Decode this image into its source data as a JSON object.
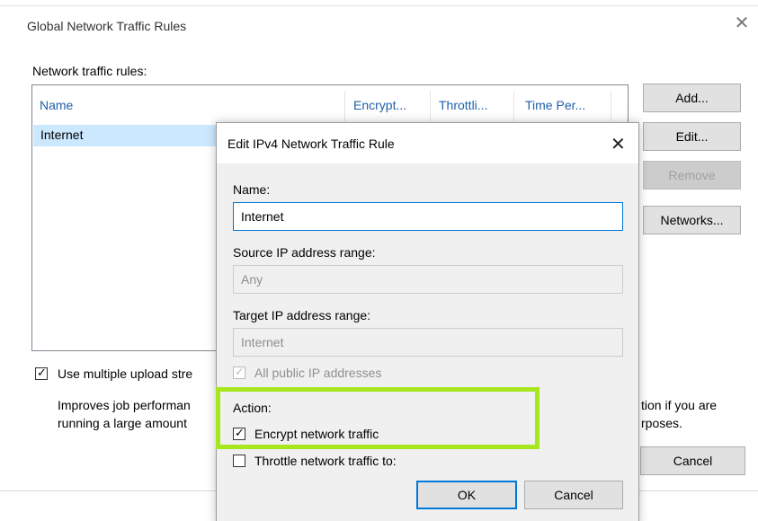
{
  "outer": {
    "title": "Global Network Traffic Rules",
    "close_glyph": "✕",
    "rules_label": "Network traffic rules:",
    "columns": [
      "Name",
      "Encrypt...",
      "Throttli...",
      "Time Per..."
    ],
    "rows": [
      {
        "name": "Internet"
      }
    ],
    "buttons": {
      "add": "Add...",
      "edit": "Edit...",
      "remove": "Remove",
      "networks": "Networks...",
      "cancel": "Cancel"
    },
    "multi_upload_label": "Use multiple upload stre",
    "description_left_1": "Improves job performan",
    "description_left_2": "running a large amount",
    "description_right_1": "tion if you are",
    "description_right_2": "rposes."
  },
  "inner": {
    "title": "Edit IPv4 Network Traffic Rule",
    "close_glyph": "✕",
    "name_label": "Name:",
    "name_value": "Internet",
    "source_label": "Source IP address range:",
    "source_value": "Any",
    "target_label": "Target IP address range:",
    "target_value": "Internet",
    "all_public_label": "All public IP addresses",
    "action_label": "Action:",
    "encrypt_label": "Encrypt network traffic",
    "throttle_label": "Throttle network traffic to:",
    "ok": "OK",
    "cancel": "Cancel"
  },
  "colors": {
    "accent": "#0078d7",
    "highlight": "#a8e61d",
    "header_text": "#1f5fa9",
    "selection": "#cce8ff"
  }
}
